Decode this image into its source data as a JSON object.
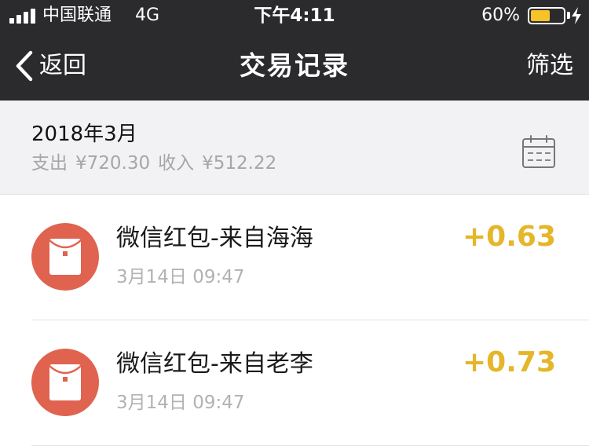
{
  "status_bar": {
    "carrier": "中国联通",
    "network": "4G",
    "time": "下午4:11",
    "battery_percent": "60%",
    "battery_level": 0.6,
    "battery_color": "#f7c22a"
  },
  "nav": {
    "back_label": "返回",
    "title": "交易记录",
    "filter_label": "筛选"
  },
  "summary": {
    "month": "2018年3月",
    "expense_label": "支出",
    "expense_amount": "¥720.30",
    "income_label": "收入",
    "income_amount": "¥512.22",
    "calendar_icon": "calendar-icon"
  },
  "transactions": [
    {
      "title": "微信红包-来自海海",
      "time": "3月14日 09:47",
      "amount": "+0.63",
      "icon": "red-packet-icon"
    },
    {
      "title": "微信红包-来自老李",
      "time": "3月14日 09:47",
      "amount": "+0.73",
      "icon": "red-packet-icon"
    }
  ],
  "colors": {
    "header_bg": "#2b2b2e",
    "summary_bg": "#f2f2f4",
    "avatar_red": "#e0634f",
    "amount_gold": "#e5b629",
    "muted_text": "#a6a6a6"
  }
}
